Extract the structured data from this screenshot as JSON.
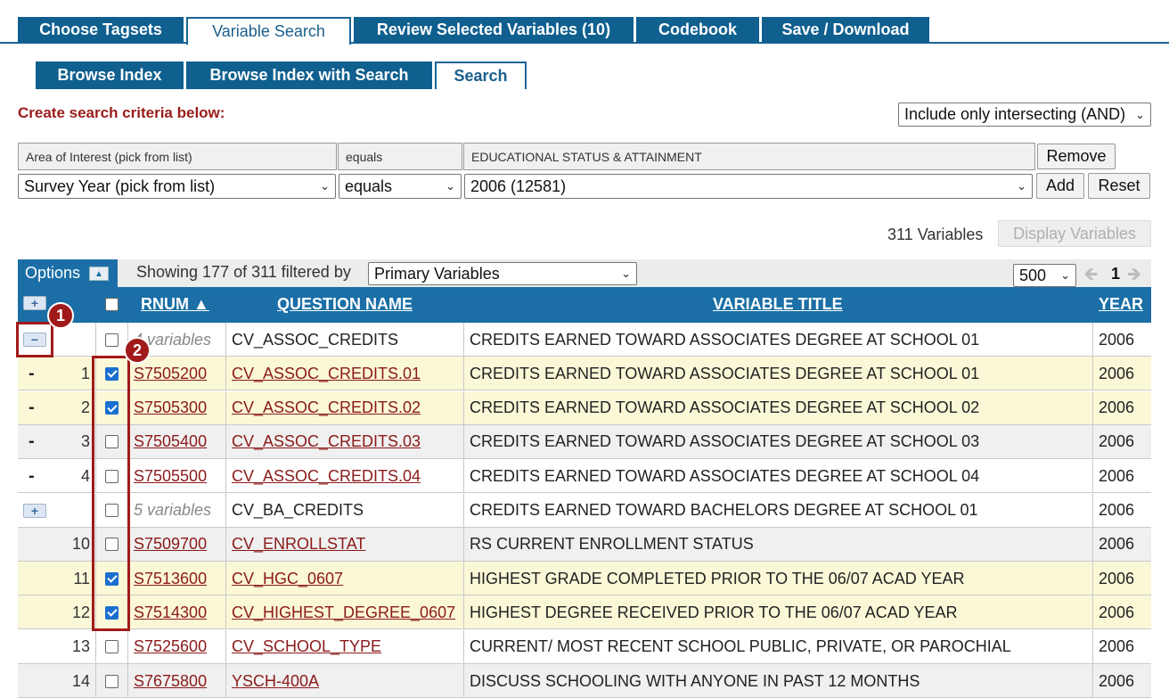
{
  "top_tabs": [
    {
      "label": "Choose Tagsets",
      "active": false
    },
    {
      "label": "Variable Search",
      "active": true
    },
    {
      "label": "Review Selected Variables (10)",
      "active": false
    },
    {
      "label": "Codebook",
      "active": false
    },
    {
      "label": "Save / Download",
      "active": false
    }
  ],
  "sub_tabs": [
    {
      "label": "Browse Index",
      "active": false
    },
    {
      "label": "Browse Index with Search",
      "active": false
    },
    {
      "label": "Search",
      "active": true
    }
  ],
  "search": {
    "create_label": "Create search criteria below:",
    "logic_select": "Include only intersecting (AND)",
    "criteria_row": {
      "field": "Area of Interest   (pick from list)",
      "op": "equals",
      "value": "EDUCATIONAL STATUS & ATTAINMENT",
      "remove_label": "Remove"
    },
    "new_row": {
      "field": "Survey Year   (pick from list)",
      "op": "equals",
      "value": "2006 (12581)",
      "add_label": "Add",
      "reset_label": "Reset"
    }
  },
  "results": {
    "count_text": "311 Variables",
    "display_label": "Display Variables"
  },
  "options_bar": {
    "options_label": "Options",
    "showing_text": "Showing 177 of 311  filtered by",
    "filter_select": "Primary Variables",
    "page_size": "500",
    "page": "1"
  },
  "table": {
    "headers": {
      "rnum": "RNUM ▲",
      "question": "QUESTION NAME",
      "title": "VARIABLE TITLE",
      "year": "YEAR"
    },
    "rows": [
      {
        "kind": "group",
        "expander": "−",
        "count": "4 variables",
        "checked": false,
        "question": "CV_ASSOC_CREDITS",
        "title": "CREDITS EARNED TOWARD ASSOCIATES DEGREE AT SCHOOL 01",
        "year": "2006",
        "bg": "white"
      },
      {
        "kind": "child",
        "num": "1",
        "checked": true,
        "rnum": "S7505200",
        "question": "CV_ASSOC_CREDITS.01",
        "title": "CREDITS EARNED TOWARD ASSOCIATES DEGREE AT SCHOOL 01",
        "year": "2006",
        "bg": "yellow"
      },
      {
        "kind": "child",
        "num": "2",
        "checked": true,
        "rnum": "S7505300",
        "question": "CV_ASSOC_CREDITS.02",
        "title": "CREDITS EARNED TOWARD ASSOCIATES DEGREE AT SCHOOL 02",
        "year": "2006",
        "bg": "yellow"
      },
      {
        "kind": "child",
        "num": "3",
        "checked": false,
        "rnum": "S7505400",
        "question": "CV_ASSOC_CREDITS.03",
        "title": "CREDITS EARNED TOWARD ASSOCIATES DEGREE AT SCHOOL 03",
        "year": "2006",
        "bg": "gray"
      },
      {
        "kind": "child",
        "num": "4",
        "checked": false,
        "rnum": "S7505500",
        "question": "CV_ASSOC_CREDITS.04",
        "title": "CREDITS EARNED TOWARD ASSOCIATES DEGREE AT SCHOOL 04",
        "year": "2006",
        "bg": "white"
      },
      {
        "kind": "group",
        "expander": "+",
        "count": "5 variables",
        "checked": false,
        "question": "CV_BA_CREDITS",
        "title": "CREDITS EARNED TOWARD BACHELORS DEGREE AT SCHOOL 01",
        "year": "2006",
        "bg": "white"
      },
      {
        "kind": "item",
        "num": "10",
        "checked": false,
        "rnum": "S7509700",
        "question": "CV_ENROLLSTAT",
        "title": "RS CURRENT ENROLLMENT STATUS",
        "year": "2006",
        "bg": "gray"
      },
      {
        "kind": "item",
        "num": "11",
        "checked": true,
        "rnum": "S7513600",
        "question": "CV_HGC_0607",
        "title": "HIGHEST GRADE COMPLETED PRIOR TO THE 06/07 ACAD YEAR",
        "year": "2006",
        "bg": "yellow"
      },
      {
        "kind": "item",
        "num": "12",
        "checked": true,
        "rnum": "S7514300",
        "question": "CV_HIGHEST_DEGREE_0607",
        "title": "HIGHEST DEGREE RECEIVED PRIOR TO THE 06/07 ACAD YEAR",
        "year": "2006",
        "bg": "yellow"
      },
      {
        "kind": "item",
        "num": "13",
        "checked": false,
        "rnum": "S7525600",
        "question": "CV_SCHOOL_TYPE",
        "title": "CURRENT/ MOST RECENT SCHOOL PUBLIC, PRIVATE, OR PAROCHIAL",
        "year": "2006",
        "bg": "white"
      },
      {
        "kind": "item",
        "num": "14",
        "checked": false,
        "rnum": "S7675800",
        "question": "YSCH-400A",
        "title": "DISCUSS SCHOOLING WITH ANYONE IN PAST 12 MONTHS",
        "year": "2006",
        "bg": "gray"
      }
    ]
  },
  "annotations": {
    "badge1": "1",
    "badge2": "2"
  }
}
